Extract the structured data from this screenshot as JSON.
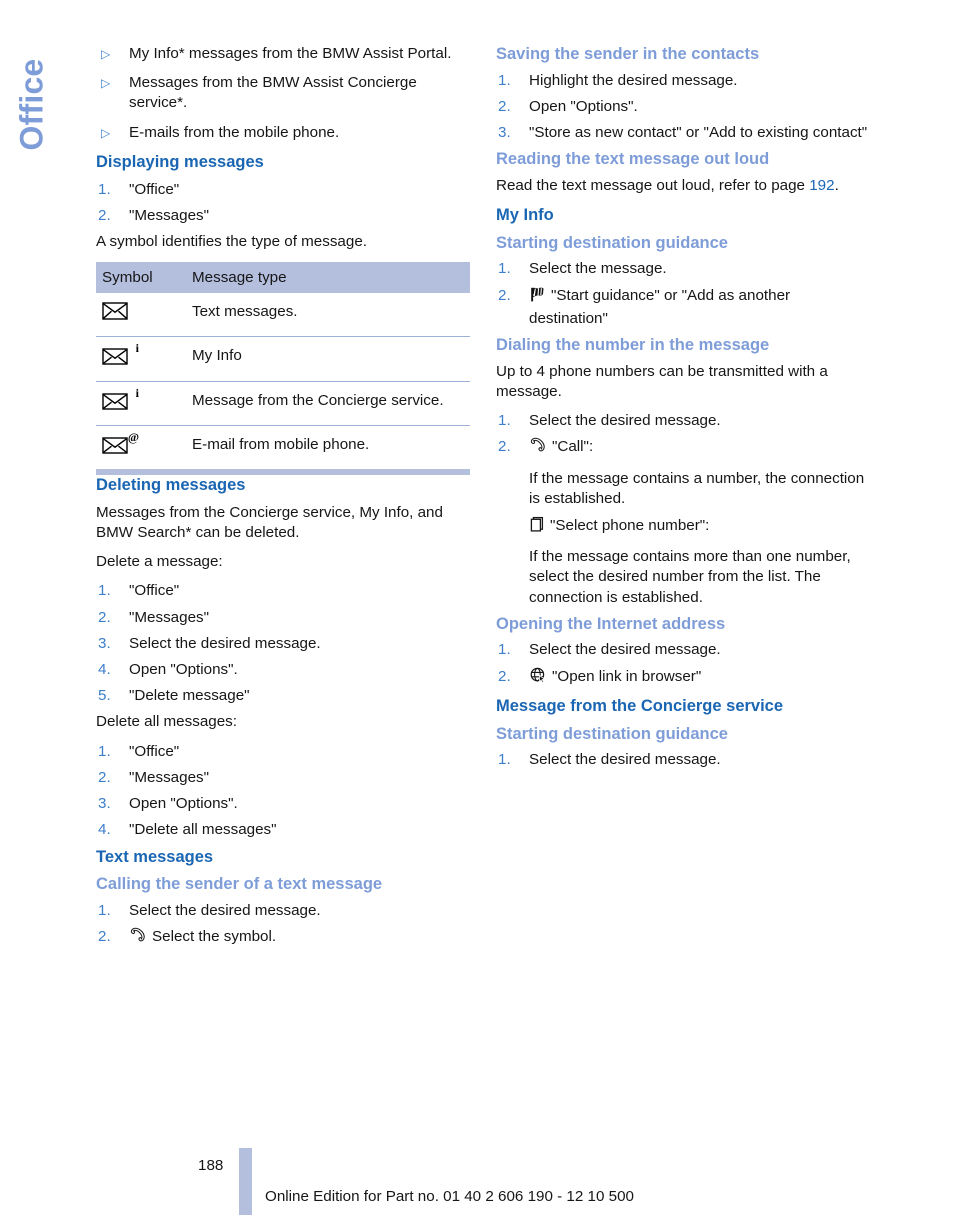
{
  "section_tab": {
    "label": "Office"
  },
  "left_column": {
    "intro_bullets": [
      {
        "marker": "▷",
        "text": "My Info* messages from the BMW Assist Portal."
      },
      {
        "marker": "▷",
        "text": "Messages from the BMW Assist Concierge service*."
      },
      {
        "marker": "▷",
        "text": "E-mails from the mobile phone."
      }
    ],
    "displaying": {
      "heading": "Displaying messages",
      "steps": [
        {
          "n": "1.",
          "text": "\"Office\""
        },
        {
          "n": "2.",
          "text": "\"Messages\""
        }
      ],
      "note": "A symbol identifies the type of message."
    },
    "symbol_table": {
      "headers": {
        "col1": "Symbol",
        "col2": "Message type"
      },
      "rows": [
        {
          "symbol_icon": "envelope-icon",
          "symbol_sup": "",
          "type": "Text messages."
        },
        {
          "symbol_icon": "envelope-info-icon",
          "symbol_sup": "i",
          "type": "My Info"
        },
        {
          "symbol_icon": "envelope-info-icon",
          "symbol_sup": "i",
          "type": "Message from the Concierge service."
        },
        {
          "symbol_icon": "envelope-at-icon",
          "symbol_sup": "@",
          "type": "E-mail from mobile phone."
        }
      ]
    },
    "deleting": {
      "heading": "Deleting messages",
      "intro": "Messages from the Concierge service, My Info, and BMW Search* can be deleted.",
      "sub1_label": "Delete a message:",
      "sub1_steps": [
        {
          "n": "1.",
          "text": "\"Office\""
        },
        {
          "n": "2.",
          "text": "\"Messages\""
        },
        {
          "n": "3.",
          "text": "Select the desired message."
        },
        {
          "n": "4.",
          "text": "Open \"Options\"."
        },
        {
          "n": "5.",
          "text": "\"Delete message\""
        }
      ],
      "sub2_label": "Delete all messages:",
      "sub2_steps": [
        {
          "n": "1.",
          "text": "\"Office\""
        },
        {
          "n": "2.",
          "text": "\"Messages\""
        },
        {
          "n": "3.",
          "text": "Open \"Options\"."
        },
        {
          "n": "4.",
          "text": "\"Delete all messages\""
        }
      ]
    },
    "text_messages": {
      "heading": "Text messages",
      "calling": {
        "heading": "Calling the sender of a text message",
        "steps": [
          {
            "n": "1.",
            "text": "Select the desired message.",
            "icon": ""
          },
          {
            "n": "2.",
            "text": "Select the symbol.",
            "icon": "telephone-handset-icon"
          }
        ]
      }
    }
  },
  "right_column": {
    "saving": {
      "heading": "Saving the sender in the contacts",
      "steps": [
        {
          "n": "1.",
          "text": "Highlight the desired message."
        },
        {
          "n": "2.",
          "text": "Open \"Options\"."
        },
        {
          "n": "3.",
          "text": "\"Store as new contact\" or \"Add to existing contact\""
        }
      ]
    },
    "reading": {
      "heading": "Reading the text message out loud",
      "text_before": "Read the text message out loud, refer to page ",
      "page_ref": "192",
      "text_after": "."
    },
    "my_info": {
      "heading": "My Info",
      "starting_guidance": {
        "heading": "Starting destination guidance",
        "steps": [
          {
            "n": "1.",
            "text": "Select the message.",
            "icon": ""
          },
          {
            "n": "2.",
            "text": "\"Start guidance\" or \"Add as another destination\"",
            "icon": "checkered-flag-icon"
          }
        ]
      },
      "dialing": {
        "heading": "Dialing the number in the message",
        "intro": "Up to 4 phone numbers can be transmitted with a message.",
        "steps": [
          {
            "n": "1.",
            "text": "Select the desired message.",
            "icon": ""
          },
          {
            "n": "2.",
            "text": "\"Call\":",
            "icon": "telephone-handset-icon",
            "sub1": "If the message contains a number, the connection is established.",
            "sub2_icon": "list-stack-icon",
            "sub2": "\"Select phone number\":",
            "sub3": "If the message contains more than one number, select the desired number from the list. The connection is established."
          }
        ]
      },
      "opening_internet": {
        "heading": "Opening the Internet address",
        "steps": [
          {
            "n": "1.",
            "text": "Select the desired message.",
            "icon": ""
          },
          {
            "n": "2.",
            "text": "\"Open link in browser\"",
            "icon": "globe-browser-icon"
          }
        ]
      }
    },
    "concierge": {
      "heading": "Message from the Concierge service",
      "starting_guidance": {
        "heading": "Starting destination guidance",
        "steps": [
          {
            "n": "1.",
            "text": "Select the desired message."
          }
        ]
      }
    }
  },
  "footer": {
    "page_number": "188",
    "edition": "Online Edition for Part no. 01 40 2 606 190 - 12 10 500"
  }
}
